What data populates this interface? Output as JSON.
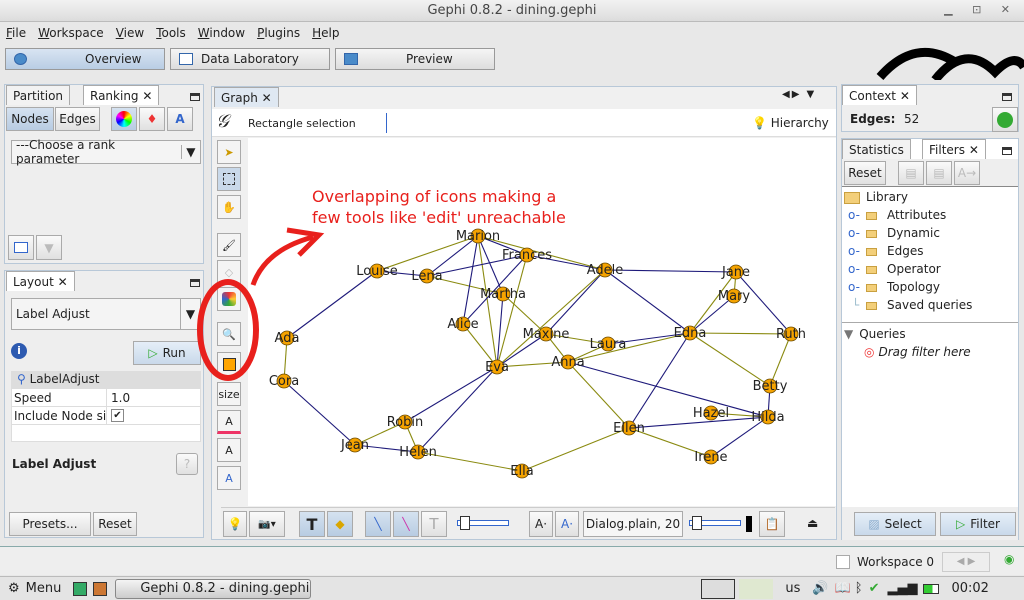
{
  "window": {
    "title": "Gephi 0.8.2 - dining.gephi",
    "controls": "▁ ⊡ ✕"
  },
  "menu": [
    "File",
    "Workspace",
    "View",
    "Tools",
    "Window",
    "Plugins",
    "Help"
  ],
  "modes": [
    "Overview",
    "Data Laboratory",
    "Preview"
  ],
  "left": {
    "tabs": [
      "Partition",
      "Ranking"
    ],
    "subtabs": [
      "Nodes",
      "Edges"
    ],
    "rank_select": "---Choose a rank parameter",
    "layout_tab": "Layout",
    "layout_select": "Label Adjust",
    "run": "Run",
    "props_header": "LabelAdjust",
    "props": [
      {
        "name": "Speed",
        "value": "1.0"
      },
      {
        "name": "Include Node siz",
        "value": "✔"
      }
    ],
    "desc_title": "Label Adjust",
    "presets": "Presets...",
    "reset": "Reset"
  },
  "graph": {
    "tab": "Graph",
    "selection_mode": "Rectangle selection",
    "hierarchy": "Hierarchy",
    "size_label": "size",
    "annotation": "Overlapping of icons making a\nfew tools like 'edit' unreachable",
    "annotation_color": "#e8201c",
    "node_color": "#f5a300",
    "edge_color_a": "#1e1a7a",
    "edge_color_b": "#8a8a10",
    "nodes": [
      "Marion",
      "Frances",
      "Louise",
      "Lena",
      "Adele",
      "Jane",
      "Mary",
      "Martha",
      "Alice",
      "Maxine",
      "Laura",
      "Edna",
      "Ruth",
      "Ada",
      "Anna",
      "Eva",
      "Cora",
      "Betty",
      "Hazel",
      "Hilda",
      "Robin",
      "Ellen",
      "Jean",
      "Helen",
      "Irene",
      "Ella"
    ],
    "edges": [
      [
        "Ada",
        "Louise"
      ],
      [
        "Cora",
        "Ada"
      ],
      [
        "Cora",
        "Jean"
      ],
      [
        "Jean",
        "Robin"
      ],
      [
        "Jean",
        "Helen"
      ],
      [
        "Robin",
        "Helen"
      ],
      [
        "Helen",
        "Eva"
      ],
      [
        "Helen",
        "Ella"
      ],
      [
        "Robin",
        "Eva"
      ],
      [
        "Ella",
        "Ellen"
      ],
      [
        "Ellen",
        "Edna"
      ],
      [
        "Irene",
        "Ellen"
      ],
      [
        "Irene",
        "Hilda"
      ],
      [
        "Hazel",
        "Hilda"
      ],
      [
        "Ellen",
        "Hilda"
      ],
      [
        "Eva",
        "Anna"
      ],
      [
        "Anna",
        "Hilda"
      ],
      [
        "Anna",
        "Edna"
      ],
      [
        "Laura",
        "Edna"
      ],
      [
        "Ruth",
        "Edna"
      ],
      [
        "Edna",
        "Adele"
      ],
      [
        "Edna",
        "Jane"
      ],
      [
        "Ruth",
        "Jane"
      ],
      [
        "Ruth",
        "Betty"
      ],
      [
        "Betty",
        "Hilda"
      ],
      [
        "Betty",
        "Edna"
      ],
      [
        "Jane",
        "Adele"
      ],
      [
        "Mary",
        "Jane"
      ],
      [
        "Adele",
        "Frances"
      ],
      [
        "Adele",
        "Marion"
      ],
      [
        "Maxine",
        "Adele"
      ],
      [
        "Maxine",
        "Anna"
      ],
      [
        "Maxine",
        "Eva"
      ],
      [
        "Martha",
        "Maxine"
      ],
      [
        "Martha",
        "Eva"
      ],
      [
        "Martha",
        "Lena"
      ],
      [
        "Lena",
        "Marion"
      ],
      [
        "Louise",
        "Marion"
      ],
      [
        "Louise",
        "Lena"
      ],
      [
        "Alice",
        "Eva"
      ],
      [
        "Alice",
        "Marion"
      ],
      [
        "Frances",
        "Eva"
      ],
      [
        "Frances",
        "Marion"
      ],
      [
        "Marion",
        "Eva"
      ],
      [
        "Marion",
        "Martha"
      ],
      [
        "Laura",
        "Anna"
      ],
      [
        "Alice",
        "Frances"
      ],
      [
        "Eva",
        "Adele"
      ],
      [
        "Lena",
        "Frances"
      ],
      [
        "Ellen",
        "Anna"
      ],
      [
        "Mary",
        "Edna"
      ],
      [
        "Maxine",
        "Laura"
      ]
    ],
    "font": "Dialog.plain, 20"
  },
  "right": {
    "context_tab": "Context",
    "edges_label": "Edges:",
    "edges_value": "52",
    "tabs": [
      "Statistics",
      "Filters"
    ],
    "reset": "Reset",
    "library": "Library",
    "library_items": [
      "Attributes",
      "Dynamic",
      "Edges",
      "Operator",
      "Topology",
      "Saved queries"
    ],
    "queries": "Queries",
    "drag_hint": "Drag filter here",
    "select": "Select",
    "filter": "Filter"
  },
  "status": {
    "workspace": "Workspace 0"
  },
  "taskbar": {
    "menu": "Menu",
    "app": "Gephi 0.8.2 - dining.gephi",
    "lang": "us",
    "clock": "00:02"
  }
}
